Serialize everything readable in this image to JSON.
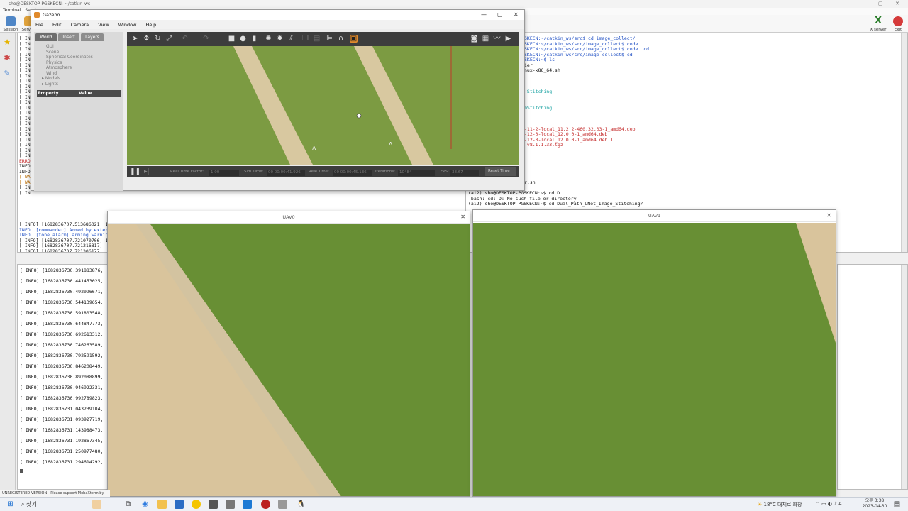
{
  "mobaxterm": {
    "window_title": "sho@DESKTOP-PGSKECN: ~/catkin_ws",
    "menu": [
      "Terminal",
      "Sessions"
    ],
    "toolbar": {
      "session": "Session",
      "servers": "Servers",
      "xserver": "X server",
      "exit": "Exit"
    },
    "unregistered": "UNREGISTERED VERSION - Please support MobaXterm by"
  },
  "term_left_top": {
    "lines_top": [
      "[ INFO]",
      "[ IN",
      "[ IN",
      "[ IN",
      "[ IN",
      "[ IN",
      "[ IN",
      "[ IN",
      "[ IN",
      "[ IN",
      "[ IN",
      "[ IN",
      "[ IN",
      "[ IN",
      "[ IN",
      "[ IN",
      "[ IN",
      "[ IN",
      "[ IN",
      "[ IN",
      "[ IN",
      "[ IN",
      "[ IN",
      "ERRO",
      "INFO",
      "INFO",
      "[ WA",
      "[ WA",
      "[ IN",
      "[ IN"
    ],
    "lines_bottom": [
      "[ INFO] [1682836707.513686021, 16.188000000]: WP: mission received",
      "INFO  [commander] Armed by external command",
      "INFO  [tone_alarm] arming warning",
      "[ INFO] [1682836707.721070706, 16.396000000]: WP: mission received",
      "[ INFO] [1682836707.721216817,",
      "[ INFO] [1682836707.721306177,",
      "INFO  [commander] Armed by exte",
      "INFO  [tone_alarm] arming warni",
      "INFO  [commander] Takeoff detec",
      "INFO  [commander] Takeoff detec"
    ]
  },
  "term_left_bottom": {
    "lines": [
      "[ INFO] [1682836730.391883876,",
      "[ INFO] [1682836730.441453025,",
      "[ INFO] [1682836730.492096671,",
      "[ INFO] [1682836730.544139654,",
      "[ INFO] [1682836730.591803548,",
      "[ INFO] [1682836730.644847773,",
      "[ INFO] [1682836730.692613312,",
      "[ INFO] [1682836730.746263589,",
      "[ INFO] [1682836730.792591592,",
      "[ INFO] [1682836730.846208449,",
      "[ INFO] [1682836730.892088899,",
      "[ INFO] [1682836730.946922331,",
      "[ INFO] [1682836730.992789823,",
      "[ INFO] [1682836731.043239104,",
      "[ INFO] [1682836731.093927719,",
      "[ INFO] [1682836731.143988473,",
      "[ INFO] [1682836731.192867345,",
      "[ INFO] [1682836731.250977480,",
      "[ INFO] [1682836731.294614292,"
    ]
  },
  "term_right_top": {
    "lines": [
      "SKECN:~/catkin_ws/src$ cd image_collect/",
      "SKECN:~/catkin_ws/src/image_collect$ code .",
      "SKECN:~/catkin_ws/src/image_collect$ code .cd",
      "SKECN:~/catkin_ws/src/image_collect$ cd",
      "SKECN:~$ ls",
      "ier",
      "nux-x86_64.sh",
      "",
      "",
      "",
      "_Stitching",
      "",
      "",
      "mStitching",
      "",
      "",
      "",
      "-11-2-local_11.2.2-460.32.03-1_amd64.deb",
      "-12-0-local_12.0.0-1_amd64.deb",
      "-12-0-local_12.0.0-1_amd64.deb.1",
      "-v8.1.1.33.tgz"
    ],
    "sh_line": "r.sh",
    "prompt_lines": [
      "(ai2) sho@DESKTOP-PGSKECN:~$ cd D",
      "-bash: cd: D: No such file or directory",
      "(ai2) sho@DESKTOP-PGSKECN:~$ cd Dual_Path_UNet_Image_Stitching/"
    ]
  },
  "gazebo": {
    "title": "Gazebo",
    "menu": [
      "File",
      "Edit",
      "Camera",
      "View",
      "Window",
      "Help"
    ],
    "tabs": [
      "World",
      "Insert",
      "Layers"
    ],
    "tree": [
      "GUI",
      "Scene",
      "Spherical Coordinates",
      "Physics",
      "Atmosphere",
      "Wind",
      "Models",
      "Lights"
    ],
    "prop_header": {
      "property": "Property",
      "value": "Value"
    },
    "status": {
      "rtf_label": "Real Time Factor:",
      "rtf_value": "1.00",
      "sim_label": "Sim Time:",
      "sim_value": "00 00:00:41.926",
      "real_label": "Real Time:",
      "real_value": "00 00:00:45.136",
      "iter_label": "Iterations:",
      "iter_value": "10484",
      "fps_label": "FPS:",
      "fps_value": "38.67",
      "reset": "Reset Time"
    }
  },
  "uav0": {
    "title": "UAV0"
  },
  "uav1": {
    "title": "UAV1"
  },
  "taskbar": {
    "search": "찾기",
    "weather": "18°C 대체로 화창",
    "time": "오후 3:38",
    "date": "2023-04-30"
  },
  "colors": {
    "grass": "#688f34",
    "road": "#d9c49c",
    "gazebo_dark": "#3d3d3d"
  }
}
